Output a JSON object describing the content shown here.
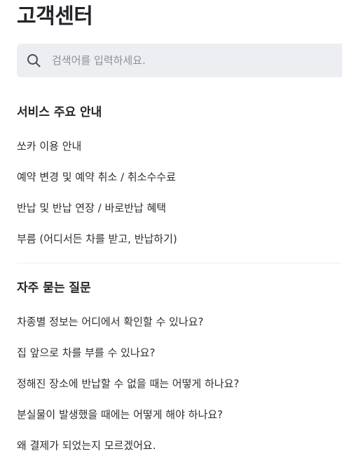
{
  "page": {
    "title": "고객센터"
  },
  "search": {
    "placeholder": "검색어를 입력하세요.",
    "value": ""
  },
  "guide": {
    "title": "서비스 주요 안내",
    "items": [
      "쏘카 이용 안내",
      "예약 변경 및 예약 취소 / 취소수수료",
      "반납 및 반납 연장 / 바로반납 혜택",
      "부름 (어디서든 차를 받고, 반납하기)"
    ]
  },
  "faq": {
    "title": "자주 묻는 질문",
    "items": [
      "차종별 정보는 어디에서 확인할 수 있나요?",
      "집 앞으로 차를 부를 수 있나요?",
      "정해진 장소에 반납할 수 없을 때는 어떻게 하나요?",
      "분실물이 발생했을 때에는 어떻게 해야 하나요?",
      "왜 결제가 되었는지 모르겠어요."
    ]
  },
  "colors": {
    "search_background": "#eceef1",
    "text": "#2b2f33",
    "placeholder": "#8a9096"
  },
  "icons": {
    "search": "search-icon"
  }
}
